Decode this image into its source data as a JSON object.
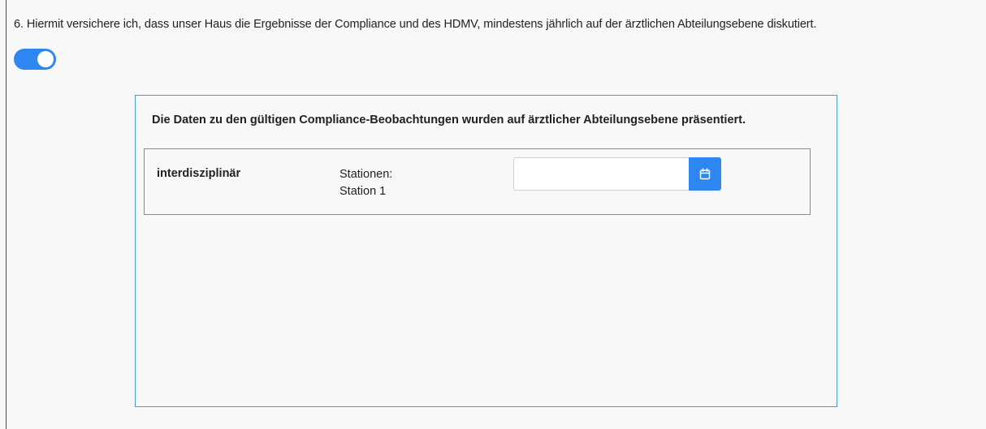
{
  "question": {
    "text": "6. Hiermit versichere ich, dass unser Haus die Ergebnisse der Compliance und des HDMV, mindestens jährlich auf der ärztlichen Abteilungsebene diskutiert."
  },
  "toggle": {
    "state": "on",
    "icon": "toggle-switch"
  },
  "panel": {
    "title": "Die Daten zu den gültigen Compliance-Beobachtungen wurden auf ärztlicher Abteilungsebene präsentiert.",
    "rows": [
      {
        "department": "interdisziplinär",
        "stations_label": "Stationen:",
        "stations_value": "Station 1",
        "date_value": "",
        "date_placeholder": "",
        "calendar_icon": "calendar-icon"
      }
    ]
  },
  "colors": {
    "accent": "#2e86f0",
    "panel_border": "#4a9bd6",
    "background": "#f8f8f8"
  }
}
